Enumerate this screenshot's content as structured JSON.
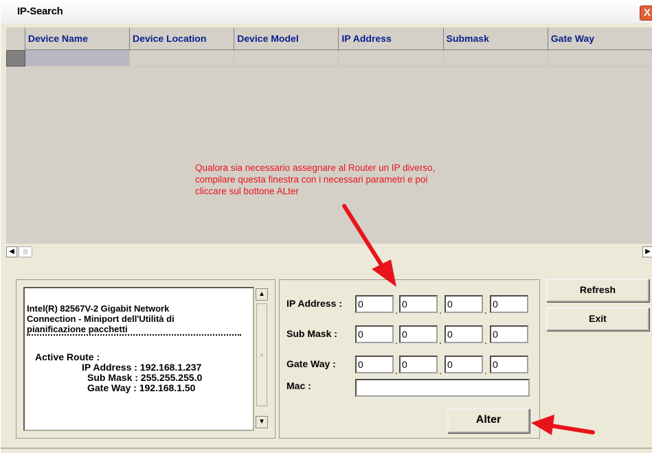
{
  "window": {
    "title": "IP-Search",
    "close_label": "X"
  },
  "grid": {
    "columns": [
      "Device Name",
      "Device Location",
      "Device Model",
      "IP Address",
      "Submask",
      "Gate Way"
    ]
  },
  "annotation": [
    "Qualora sia necessario assegnare al Router un IP diverso,",
    "compilare questa finestra con i necessari parametri e poi",
    "cliccare sul bottone ALter"
  ],
  "adapter_info": {
    "line1": "Intel(R) 82567V-2 Gigabit Network",
    "line2": "Connection - Miniport dell'Utilità di",
    "line3": "pianificazione pacchetti",
    "active_route": "Active Route :",
    "ip": "IP Address : 192.168.1.237",
    "mask": "Sub Mask : 255.255.255.0",
    "gateway": "Gate Way : 192.168.1.50"
  },
  "form": {
    "ip_label": "IP Address :",
    "mask_label": "Sub Mask :",
    "gateway_label": "Gate Way :",
    "mac_label": "Mac :",
    "ip": [
      "0",
      "0",
      "0",
      "0"
    ],
    "mask": [
      "0",
      "0",
      "0",
      "0"
    ],
    "gateway": [
      "0",
      "0",
      "0",
      "0"
    ],
    "mac": "",
    "alter_label": "Alter"
  },
  "buttons": {
    "refresh": "Refresh",
    "exit": "Exit"
  },
  "colors": {
    "annotation": "#e8141a",
    "header_text": "#0a1e8c"
  },
  "scroll_icons": {
    "left": "left-arrow-icon",
    "right": "right-arrow-icon",
    "up": "up-arrow-icon",
    "down": "down-arrow-icon"
  }
}
